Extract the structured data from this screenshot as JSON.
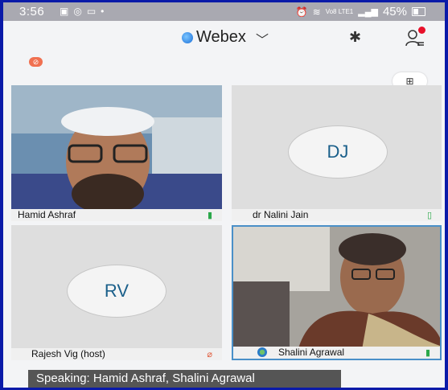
{
  "status_bar": {
    "time": "3:56",
    "battery": "45%",
    "signal_text": "Vo8 LTE1"
  },
  "header": {
    "title": "Webex",
    "icons": [
      "webex-logo-icon",
      "chevron-down-icon",
      "bluetooth-icon",
      "participants-icon"
    ]
  },
  "participants": [
    {
      "name": "Hamid Ashraf",
      "initials": "",
      "video": true,
      "mic": "on"
    },
    {
      "name": "dr Nalini Jain",
      "initials": "DJ",
      "video": false,
      "mic": "on"
    },
    {
      "name": "Rajesh Vig (host)",
      "initials": "RV",
      "video": false,
      "mic": "muted"
    },
    {
      "name": "Shalini Agrawal",
      "initials": "",
      "video": true,
      "mic": "on",
      "active_speaker": true
    }
  ],
  "speaking": "Speaking: Hamid Ashraf, Shalini Agrawal",
  "colors": {
    "frame_border": "#0a1aa8",
    "active_speaker_border": "#4a90c8",
    "mic_on": "#2ba84a",
    "mic_muted": "#e05a3a"
  }
}
